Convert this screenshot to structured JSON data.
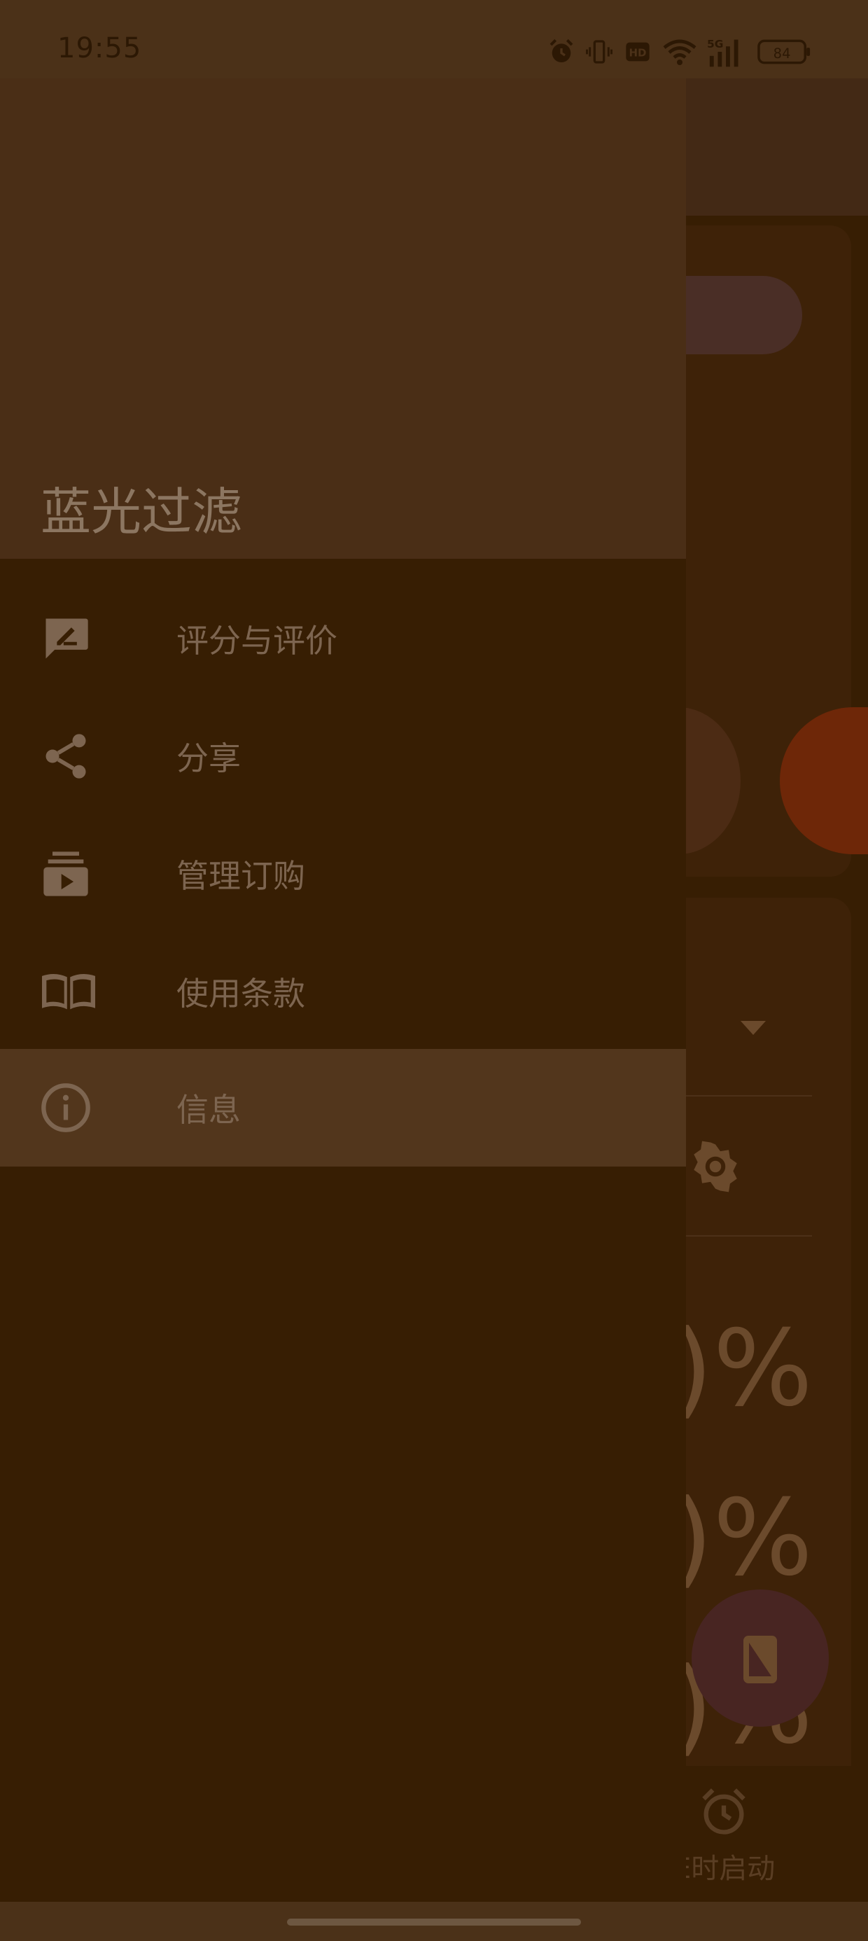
{
  "status_bar": {
    "time": "19:55",
    "icons": [
      "alarm-icon",
      "vibrate-icon",
      "hd-icon",
      "wifi-icon",
      "5g-signal-icon",
      "battery-icon"
    ],
    "network": "5G",
    "battery": "84"
  },
  "drawer": {
    "title": "蓝光过滤",
    "items": [
      {
        "label": "评分与评价",
        "icon": "rate-review-icon"
      },
      {
        "label": "分享",
        "icon": "share-icon"
      },
      {
        "label": "管理订购",
        "icon": "subscriptions-icon"
      },
      {
        "label": "使用条款",
        "icon": "book-icon"
      },
      {
        "label": "信息",
        "icon": "info-icon",
        "active": true
      }
    ]
  },
  "background": {
    "percent_texts": [
      ")%",
      ")%",
      ")%"
    ],
    "timer_label": "E时启动"
  },
  "colors": {
    "scrim_background": "#371e03",
    "drawer_header": "#4a2e16",
    "active_item": "#52361c",
    "text": "#7d6550"
  }
}
